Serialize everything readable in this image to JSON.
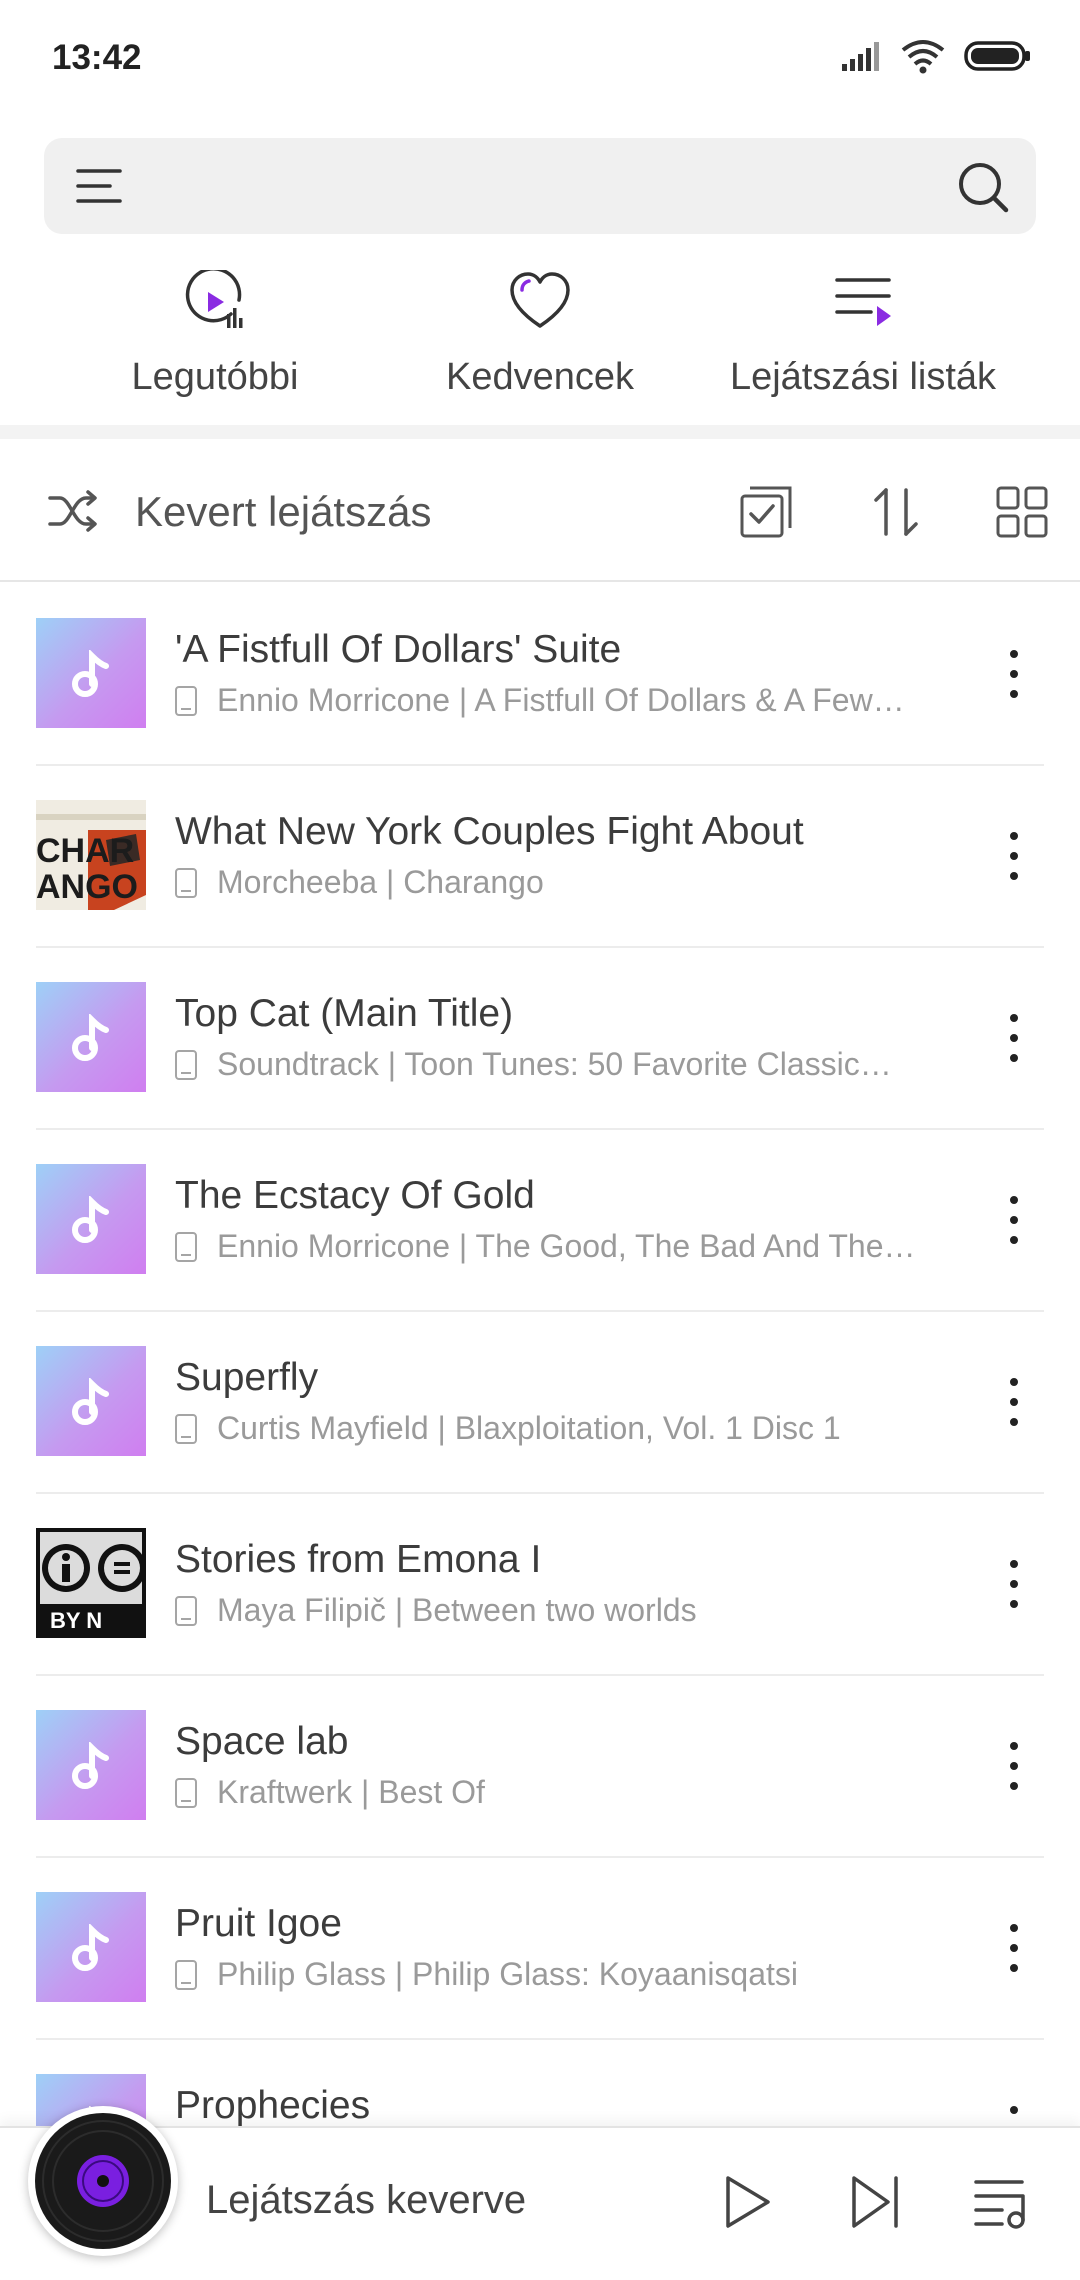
{
  "status_bar": {
    "time": "13:42"
  },
  "search": {
    "placeholder": ""
  },
  "quick_tabs": [
    {
      "label": "Legutóbbi",
      "icon": "recent-play-icon"
    },
    {
      "label": "Kedvencek",
      "icon": "heart-icon"
    },
    {
      "label": "Lejátszási listák",
      "icon": "playlist-icon"
    }
  ],
  "toolbar": {
    "shuffle_label": "Kevert lejátszás"
  },
  "songs": [
    {
      "title": "'A Fistfull Of Dollars' Suite",
      "subtitle": "Ennio Morricone | A Fistfull Of Dollars & A Few…",
      "art": "default-note"
    },
    {
      "title": "What New York Couples Fight About",
      "subtitle": "Morcheeba | Charango",
      "art": "charango-cover"
    },
    {
      "title": "Top Cat (Main Title)",
      "subtitle": "Soundtrack | Toon Tunes: 50 Favorite Classic…",
      "art": "default-note"
    },
    {
      "title": "The Ecstacy Of Gold",
      "subtitle": "Ennio Morricone | The Good, The Bad And The…",
      "art": "default-note"
    },
    {
      "title": "Superfly",
      "subtitle": "Curtis Mayfield | Blaxploitation, Vol. 1 Disc 1",
      "art": "default-note"
    },
    {
      "title": "Stories from Emona I",
      "subtitle": "Maya Filipič | Between two worlds",
      "art": "cc-by-cover"
    },
    {
      "title": "Space lab",
      "subtitle": "Kraftwerk | Best Of",
      "art": "default-note"
    },
    {
      "title": "Pruit Igoe",
      "subtitle": "Philip Glass | Philip Glass: Koyaanisqatsi",
      "art": "default-note"
    },
    {
      "title": "Prophecies",
      "subtitle": "",
      "art": "default-note"
    }
  ],
  "mini_player": {
    "label": "Lejátszás keverve"
  },
  "colors": {
    "accent": "#8a2be2",
    "art_gradient_start": "#9ed0f7",
    "art_gradient_end": "#d07ef0"
  }
}
